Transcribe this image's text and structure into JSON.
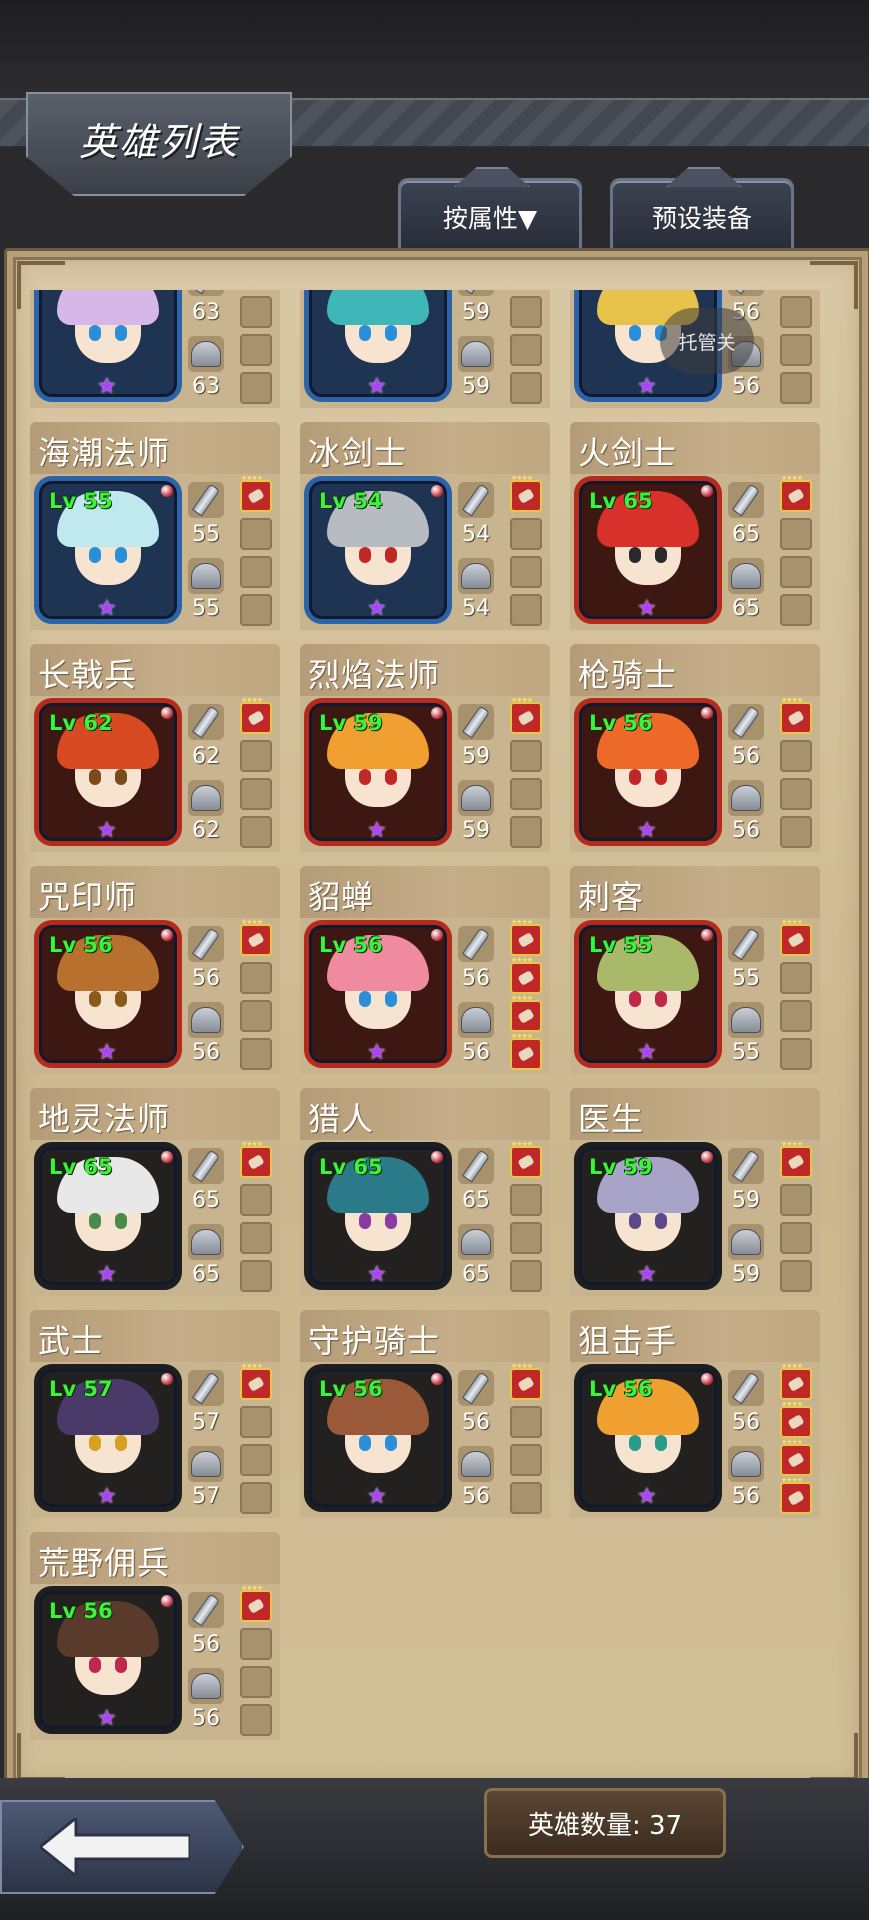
{
  "page_title": "英雄列表",
  "tabs": {
    "sort_label": "按属性▼",
    "preset_label": "预设装备"
  },
  "tuoguan_label": "托管关",
  "hero_count": "英雄数量: 37",
  "partial_top_row": [
    {
      "attack": "63",
      "defense": "63",
      "frame": "blue",
      "hair": "#d7b6e8"
    },
    {
      "attack": "59",
      "defense": "59",
      "frame": "blue",
      "hair": "#3fb6b8"
    },
    {
      "attack": "56",
      "defense": "56",
      "frame": "blue",
      "hair": "#e6c24a"
    }
  ],
  "heroes": [
    {
      "name": "海潮法师",
      "level": "Lv 55",
      "attack": "55",
      "defense": "55",
      "frame": "blue",
      "hair": "#bfe9ef",
      "eyes": "#2a8fd8",
      "slots": [
        true,
        false,
        false,
        false
      ]
    },
    {
      "name": "冰剑士",
      "level": "Lv 54",
      "attack": "54",
      "defense": "54",
      "frame": "blue",
      "hair": "#b7bcc3",
      "eyes": "#c02828",
      "slots": [
        true,
        false,
        false,
        false
      ]
    },
    {
      "name": "火剑士",
      "level": "Lv 65",
      "attack": "65",
      "defense": "65",
      "frame": "red",
      "hair": "#d8302a",
      "eyes": "#2a2a2a",
      "slots": [
        true,
        false,
        false,
        false
      ]
    },
    {
      "name": "长戟兵",
      "level": "Lv 62",
      "attack": "62",
      "defense": "62",
      "frame": "red",
      "hair": "#d84a22",
      "eyes": "#7a4a1a",
      "slots": [
        true,
        false,
        false,
        false
      ]
    },
    {
      "name": "烈焰法师",
      "level": "Lv 59",
      "attack": "59",
      "defense": "59",
      "frame": "red",
      "hair": "#f0a030",
      "eyes": "#c02828",
      "slots": [
        true,
        false,
        false,
        false
      ]
    },
    {
      "name": "枪骑士",
      "level": "Lv 56",
      "attack": "56",
      "defense": "56",
      "frame": "red",
      "hair": "#ee6a2a",
      "eyes": "#c02828",
      "slots": [
        true,
        false,
        false,
        false
      ]
    },
    {
      "name": "咒印师",
      "level": "Lv 56",
      "attack": "56",
      "defense": "56",
      "frame": "red",
      "hair": "#b8702e",
      "eyes": "#8a5a1a",
      "slots": [
        true,
        false,
        false,
        false
      ]
    },
    {
      "name": "貂蝉",
      "level": "Lv 56",
      "attack": "56",
      "defense": "56",
      "frame": "red",
      "hair": "#f08aa0",
      "eyes": "#2a8fd8",
      "slots": [
        true,
        true,
        true,
        true
      ]
    },
    {
      "name": "刺客",
      "level": "Lv 55",
      "attack": "55",
      "defense": "55",
      "frame": "red",
      "hair": "#a9b96a",
      "eyes": "#c0284a",
      "slots": [
        true,
        false,
        false,
        false
      ]
    },
    {
      "name": "地灵法师",
      "level": "Lv 65",
      "attack": "65",
      "defense": "65",
      "frame": "dark",
      "hair": "#e8e8e8",
      "eyes": "#4a8a4a",
      "slots": [
        true,
        false,
        false,
        false
      ]
    },
    {
      "name": "猎人",
      "level": "Lv 65",
      "attack": "65",
      "defense": "65",
      "frame": "dark",
      "hair": "#2a7a8a",
      "eyes": "#8a3aa0",
      "slots": [
        true,
        false,
        false,
        false
      ]
    },
    {
      "name": "医生",
      "level": "Lv 59",
      "attack": "59",
      "defense": "59",
      "frame": "dark",
      "hair": "#a8a4c8",
      "eyes": "#5a4a8a",
      "slots": [
        true,
        false,
        false,
        false
      ]
    },
    {
      "name": "武士",
      "level": "Lv 57",
      "attack": "57",
      "defense": "57",
      "frame": "dark",
      "hair": "#4a3a6a",
      "eyes": "#d8a020",
      "slots": [
        true,
        false,
        false,
        false
      ]
    },
    {
      "name": "守护骑士",
      "level": "Lv 56",
      "attack": "56",
      "defense": "56",
      "frame": "dark",
      "hair": "#9a5a3a",
      "eyes": "#2a8fd8",
      "slots": [
        true,
        false,
        false,
        false
      ]
    },
    {
      "name": "狙击手",
      "level": "Lv 56",
      "attack": "56",
      "defense": "56",
      "frame": "dark",
      "hair": "#f0a030",
      "eyes": "#2a9a8a",
      "slots": [
        true,
        true,
        true,
        true
      ]
    },
    {
      "name": "荒野佣兵",
      "level": "Lv 56",
      "attack": "56",
      "defense": "56",
      "frame": "dark",
      "hair": "#5a3a2a",
      "eyes": "#c0284a",
      "slots": [
        true,
        false,
        false,
        false
      ]
    }
  ],
  "colors": {
    "level_text": "#3df23a",
    "frame_blue": "#2b63a8",
    "frame_red": "#b52a1a",
    "frame_dark": "#1e1e1e",
    "star": "#b040ff"
  }
}
